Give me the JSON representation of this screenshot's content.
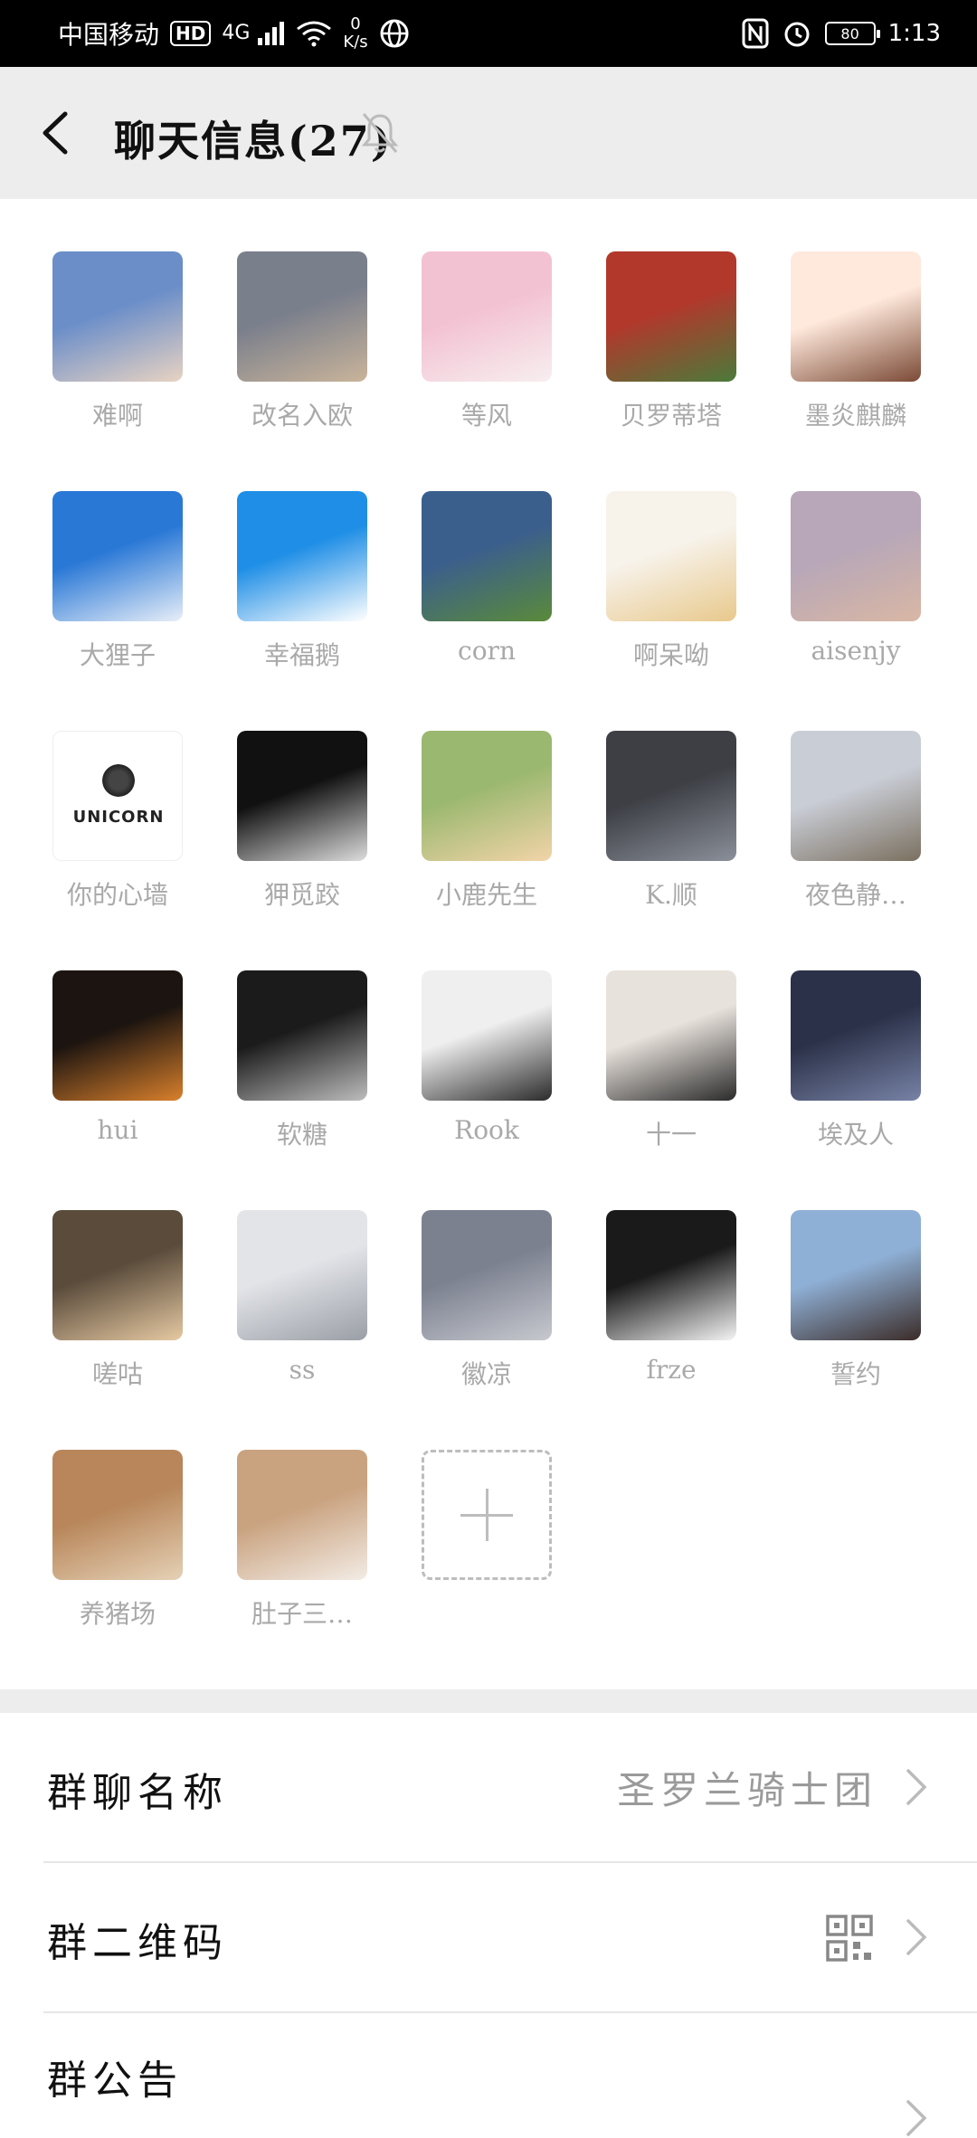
{
  "status_bar": {
    "carrier": "中国移动",
    "hd": "HD",
    "signal_gen": "4G",
    "speed_value": "0",
    "speed_unit": "K/s",
    "battery": "80",
    "time": "1:13"
  },
  "header": {
    "title": "聊天信息(27)"
  },
  "members": [
    {
      "name": "难啊",
      "avatar": [
        "#6b8ec9",
        "#e8d3c2"
      ]
    },
    {
      "name": "改名入欧",
      "avatar": [
        "#7a7f8c",
        "#c9b49a"
      ]
    },
    {
      "name": "等风",
      "avatar": [
        "#f3c2d2",
        "#f7eef0"
      ]
    },
    {
      "name": "贝罗蒂塔",
      "avatar": [
        "#b2382c",
        "#4b7a3a"
      ]
    },
    {
      "name": "墨炎麒麟",
      "avatar": [
        "#ffe9dc",
        "#7b4a36"
      ]
    },
    {
      "name": "大狸子",
      "avatar": [
        "#2a78d6",
        "#e7eef8"
      ]
    },
    {
      "name": "幸福鹅",
      "avatar": [
        "#1f8ee6",
        "#ffffff"
      ]
    },
    {
      "name": "corn",
      "avatar": [
        "#3b5f8c",
        "#5a8a3a"
      ]
    },
    {
      "name": "啊呆呦",
      "avatar": [
        "#f7f2ea",
        "#e8c98c"
      ]
    },
    {
      "name": "aisenjy",
      "avatar": [
        "#b7a7b8",
        "#d9b7a4"
      ]
    },
    {
      "name": "你的心墙",
      "avatar": [
        "#ffffff",
        "#222222"
      ],
      "logo": "UNICORN"
    },
    {
      "name": "狎觅跤",
      "avatar": [
        "#111111",
        "#dddddd"
      ]
    },
    {
      "name": "小鹿先生",
      "avatar": [
        "#9bb870",
        "#f2d4a8"
      ]
    },
    {
      "name": "K.顺",
      "avatar": [
        "#3d3f45",
        "#8a8f99"
      ]
    },
    {
      "name": "夜色静…",
      "avatar": [
        "#c9cdd6",
        "#7b7060"
      ]
    },
    {
      "name": "hui",
      "avatar": [
        "#1c1410",
        "#d9802c"
      ]
    },
    {
      "name": "软糖",
      "avatar": [
        "#1b1b1b",
        "#bdbdbd"
      ]
    },
    {
      "name": "Rook",
      "avatar": [
        "#efefef",
        "#2b2b2b"
      ]
    },
    {
      "name": "十一",
      "avatar": [
        "#e8e2dc",
        "#2b2b2b"
      ]
    },
    {
      "name": "埃及人",
      "avatar": [
        "#2b3148",
        "#7782a6"
      ]
    },
    {
      "name": "嗟咕",
      "avatar": [
        "#5a4b3b",
        "#e6c9a2"
      ]
    },
    {
      "name": "ss",
      "avatar": [
        "#e2e4e8",
        "#9a9ea6"
      ]
    },
    {
      "name": "徽凉",
      "avatar": [
        "#7c8190",
        "#c7c9cf"
      ]
    },
    {
      "name": "frze",
      "avatar": [
        "#1a1a1a",
        "#f4f4f4"
      ]
    },
    {
      "name": "誓约",
      "avatar": [
        "#8fb0d6",
        "#3b2c28"
      ]
    },
    {
      "name": "养猪场",
      "avatar": [
        "#b8865a",
        "#e5d1b6"
      ]
    },
    {
      "name": "肚子三…",
      "avatar": [
        "#c9a27f",
        "#f3ece5"
      ]
    }
  ],
  "rows": {
    "group_name_label": "群聊名称",
    "group_name_value": "圣罗兰骑士团",
    "qr_label": "群二维码",
    "notice_label": "群公告"
  },
  "icons": {
    "back": "back-arrow-icon",
    "mute": "bell-off-icon",
    "chevron": "chevron-right-icon",
    "qr": "qr-code-icon",
    "add": "plus-icon"
  }
}
